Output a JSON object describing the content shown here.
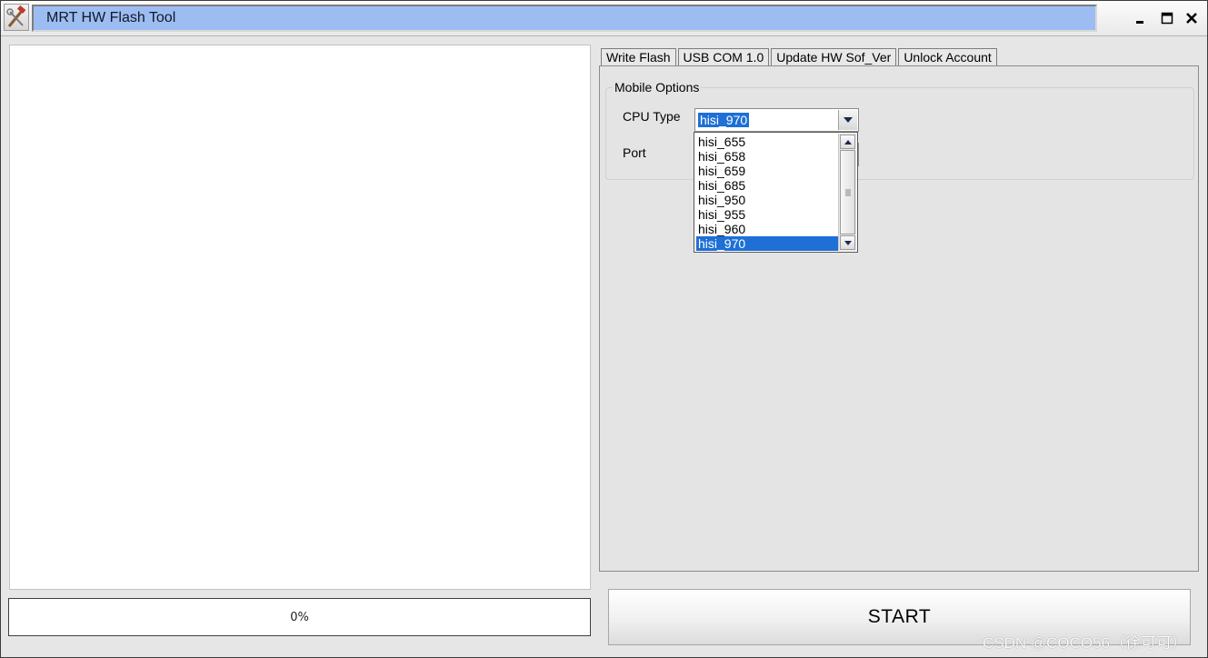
{
  "window": {
    "title": "MRT HW Flash Tool"
  },
  "tabs": [
    {
      "label": "Write Flash"
    },
    {
      "label": "USB COM 1.0"
    },
    {
      "label": "Update HW Sof_Ver"
    },
    {
      "label": "Unlock Account"
    }
  ],
  "mobile_options": {
    "group_title": "Mobile Options",
    "cpu_type_label": "CPU Type",
    "cpu_type_value": "hisi_970",
    "port_label": "Port",
    "cpu_options": [
      "hisi_655",
      "hisi_658",
      "hisi_659",
      "hisi_685",
      "hisi_950",
      "hisi_955",
      "hisi_960",
      "hisi_970"
    ],
    "selected_option_index": 7
  },
  "progress": {
    "text": "0%"
  },
  "start_button": {
    "label": "START"
  },
  "watermark": {
    "text": "CSDN @COCO56（徐可可）"
  },
  "icons": {
    "app": "wrench-hammer-icon",
    "minimize": "minimize-icon",
    "maximize": "maximize-icon",
    "close": "close-icon"
  },
  "colors": {
    "title_field": "#9dbdf2",
    "selection": "#1e6fd6"
  }
}
